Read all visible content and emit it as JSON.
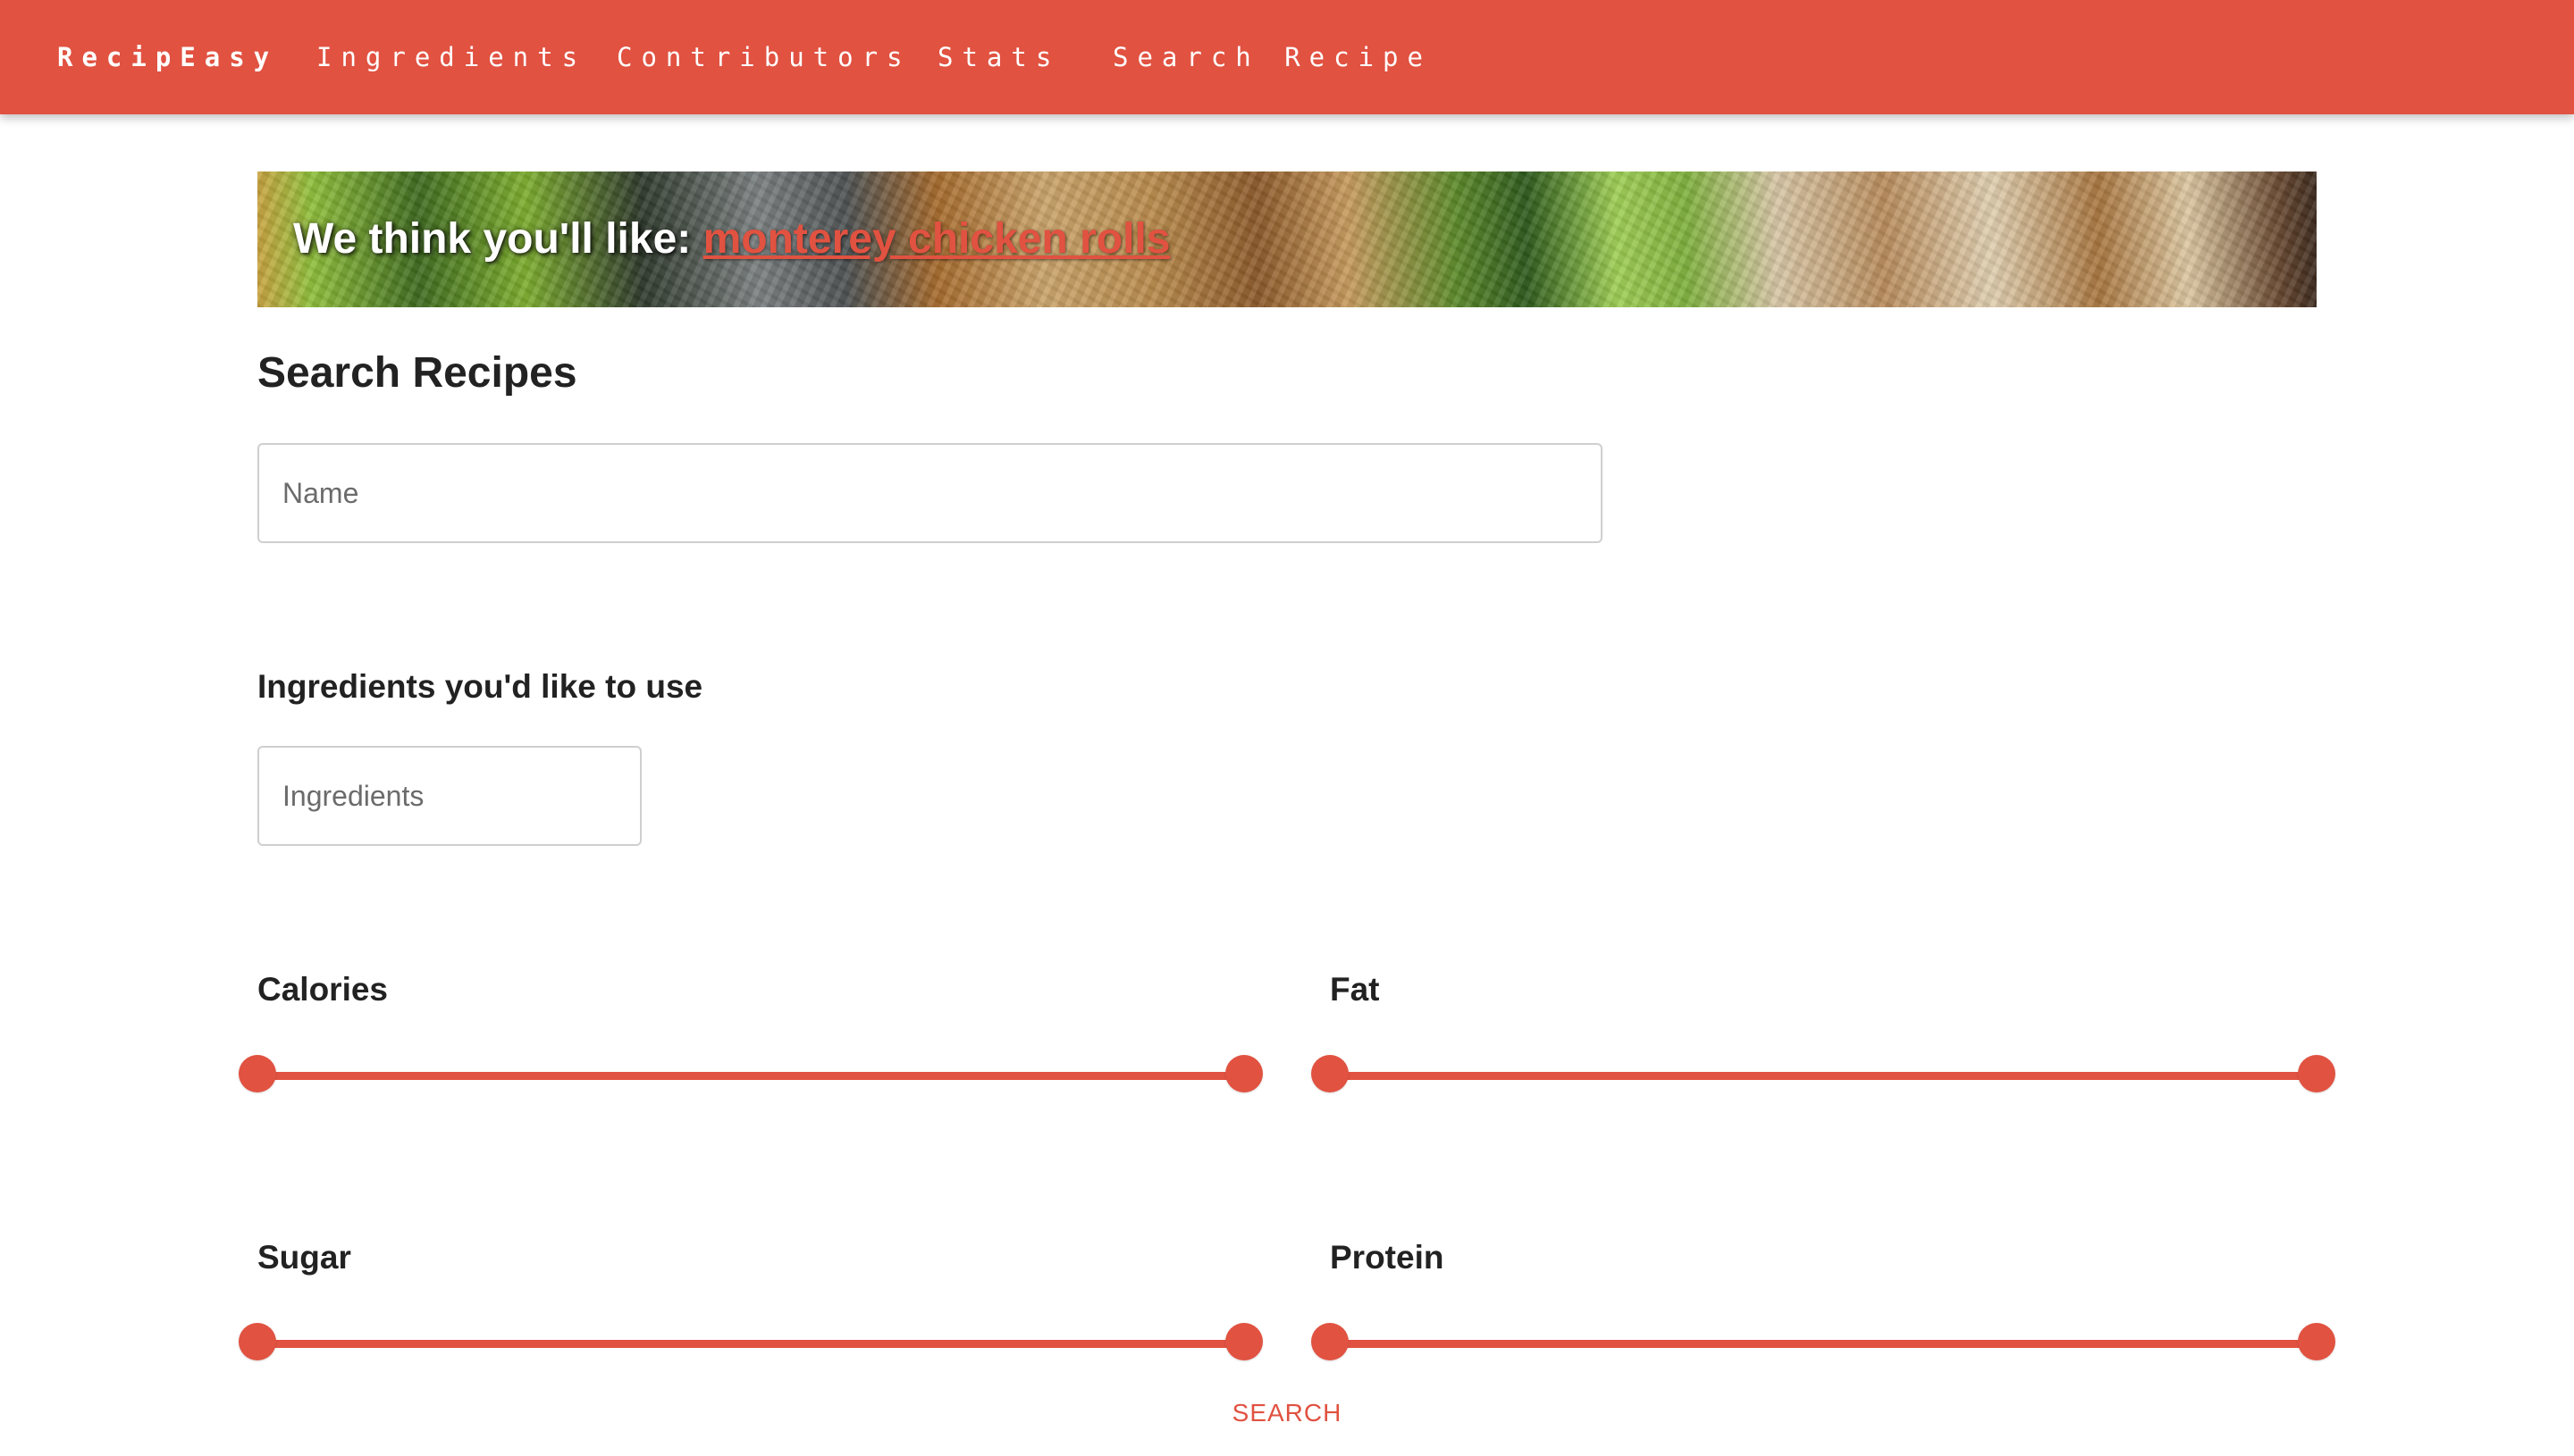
{
  "nav": {
    "brand": "RecipEasy",
    "links": [
      "Ingredients",
      "Contributors",
      "Stats",
      "Search Recipe"
    ]
  },
  "banner": {
    "prefix": "We think you'll like: ",
    "recipe": "monterey chicken rolls"
  },
  "page": {
    "title": "Search Recipes"
  },
  "name_field": {
    "placeholder": "Name",
    "value": ""
  },
  "ingredients_section": {
    "label": "Ingredients you'd like to use",
    "placeholder": "Ingredients",
    "value": ""
  },
  "sliders": [
    {
      "label": "Calories",
      "min_fraction": 0,
      "max_fraction": 1
    },
    {
      "label": "Fat",
      "min_fraction": 0,
      "max_fraction": 1
    },
    {
      "label": "Sugar",
      "min_fraction": 0,
      "max_fraction": 1
    },
    {
      "label": "Protein",
      "min_fraction": 0,
      "max_fraction": 1
    }
  ],
  "search_button": {
    "label": "SEARCH"
  },
  "colors": {
    "accent": "#e15241",
    "text": "#222222",
    "input_border": "#cfcfcf"
  }
}
